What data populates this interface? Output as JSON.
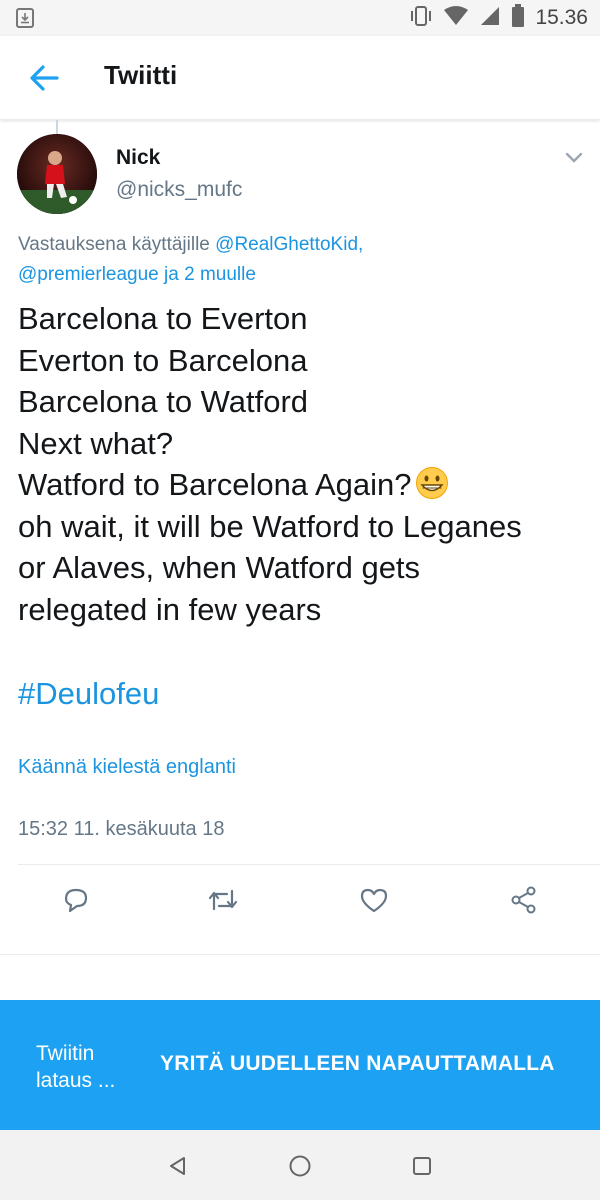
{
  "status_bar": {
    "time": "15.36",
    "icons": [
      "download-notification-icon",
      "vibrate-icon",
      "wifi-icon",
      "signal-icon",
      "battery-icon"
    ]
  },
  "header": {
    "title": "Twiitti",
    "back_icon": "arrow-left-icon"
  },
  "tweet": {
    "author_name": "Nick",
    "author_handle": "@nicks_mufc",
    "reply_prefix": "Vastauksena käyttäjille ",
    "reply_mention_1": "@RealGhettoKid,",
    "reply_mention_2": "@premierleague",
    "reply_suffix": " ja 2 muulle",
    "text_lines": [
      "Barcelona to Everton",
      "Everton to Barcelona",
      "Barcelona to Watford",
      "Next what?",
      "Watford to Barcelona Again?",
      "oh wait, it will be Watford to Leganes",
      "or Alaves, when Watford gets",
      "relegated in few years"
    ],
    "emoji": "grinning-face-emoji",
    "hashtag": "#Deulofeu",
    "translate_link": "Käännä kielestä englanti",
    "timestamp": "15:32 11. kesäkuuta 18"
  },
  "actions": [
    "reply-icon",
    "retweet-icon",
    "like-icon",
    "share-icon"
  ],
  "snackbar": {
    "message": "Twiitin lataus ...",
    "action": "YRITÄ UUDELLEEN NAPAUTTAMALLA"
  },
  "colors": {
    "accent": "#1da1f2",
    "link": "#1b95e0",
    "secondary_text": "#657786",
    "primary_text": "#14171a"
  },
  "nav": [
    "back-triangle-icon",
    "home-circle-icon",
    "recents-square-icon"
  ]
}
